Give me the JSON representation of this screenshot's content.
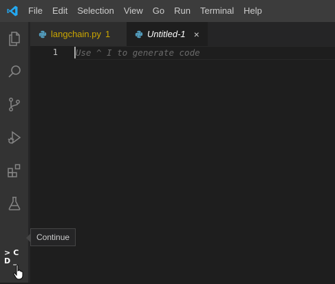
{
  "menubar": {
    "logo_icon": "vscode-logo-icon",
    "items": [
      "File",
      "Edit",
      "Selection",
      "View",
      "Go",
      "Run",
      "Terminal",
      "Help"
    ]
  },
  "activitybar": {
    "icons": [
      "explorer-icon",
      "search-icon",
      "source-control-icon",
      "run-debug-icon",
      "extensions-icon",
      "testing-icon",
      "continue-icon"
    ],
    "continue_logo": {
      "line1": ">C",
      "line2": "D_"
    }
  },
  "tabs": [
    {
      "label": "langchain.py",
      "badge": "1",
      "active": false,
      "color": "#cca700"
    },
    {
      "label": "Untitled-1",
      "close": "×",
      "active": true
    }
  ],
  "editor": {
    "line_number": "1",
    "placeholder": "Use ^ I to generate code"
  },
  "tooltip": {
    "text": "Continue"
  },
  "colors": {
    "accent": "#007acc",
    "background": "#1e1e1e",
    "activitybar": "#333333",
    "menubar": "#3c3c3c",
    "modified_tab": "#cca700"
  }
}
